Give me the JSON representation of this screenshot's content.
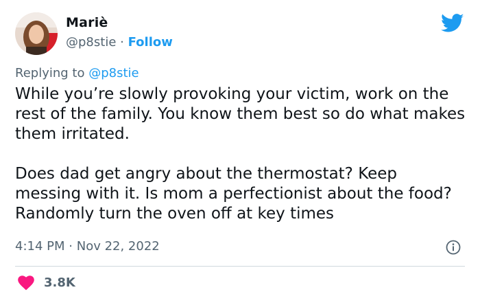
{
  "user": {
    "name": "Mariè",
    "handle": "@p8stie",
    "separator": "·",
    "follow_label": "Follow"
  },
  "reply": {
    "prefix": "Replying to",
    "mention": "@p8stie"
  },
  "tweet": {
    "paragraph_1": "While you’re slowly provoking your victim, work on the rest of the family. You know them best so do what makes them irritated.",
    "paragraph_2": "Does dad get angry about the thermostat? Keep messing with it. Is mom a perfectionist about the food? Randomly turn the oven off at key times"
  },
  "meta": {
    "time": "4:14 PM",
    "separator": "·",
    "date": "Nov 22, 2022"
  },
  "engagement": {
    "likes": "3.8K"
  },
  "icons": {
    "brand": "twitter-bird-icon",
    "info": "info-icon",
    "like": "heart-icon"
  },
  "colors": {
    "accent": "#1d9bf0",
    "secondary_text": "#536471",
    "like": "#f91880",
    "divider": "#cfd9de"
  }
}
